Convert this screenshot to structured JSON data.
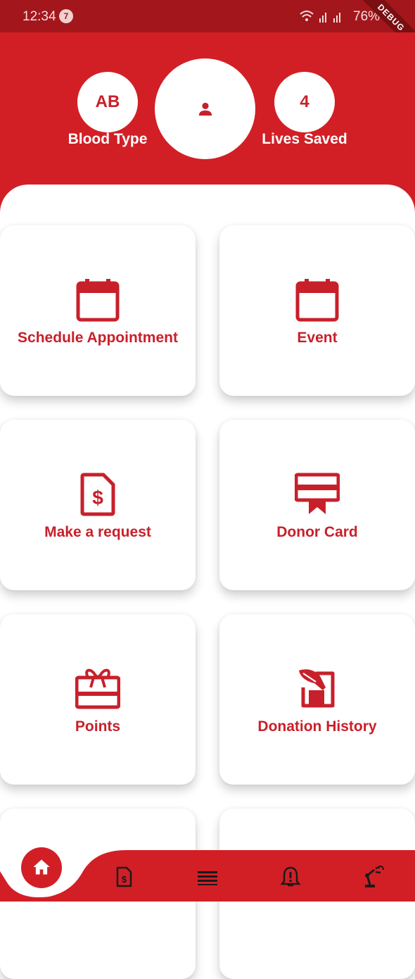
{
  "status_bar": {
    "time": "12:34",
    "notification_count": "7",
    "battery": "76%",
    "debug_label": "DEBUG"
  },
  "profile": {
    "blood_type": "AB",
    "blood_type_label": "Blood Type",
    "lives_saved": "4",
    "lives_saved_label": "Lives Saved",
    "avatar_icon": "person-icon"
  },
  "menu": {
    "items": [
      {
        "label": "Schedule Appointment",
        "icon": "calendar-icon"
      },
      {
        "label": "Event",
        "icon": "calendar-icon"
      },
      {
        "label": "Make a request",
        "icon": "dollar-document-icon"
      },
      {
        "label": "Donor Card",
        "icon": "card-ribbon-icon"
      },
      {
        "label": "Points",
        "icon": "gift-card-icon"
      },
      {
        "label": "Donation History",
        "icon": "history-pen-icon"
      }
    ]
  },
  "bottom_nav": {
    "items": [
      {
        "icon": "home-icon",
        "active": true
      },
      {
        "icon": "dollar-document-icon",
        "active": false
      },
      {
        "icon": "menu-lines-icon",
        "active": false
      },
      {
        "icon": "alert-bell-icon",
        "active": false
      },
      {
        "icon": "robot-arm-icon",
        "active": false
      }
    ]
  },
  "colors": {
    "primary": "#d21f26",
    "status_bar": "#a3171c",
    "accent_text": "#c8202a",
    "background": "#ffffff"
  }
}
